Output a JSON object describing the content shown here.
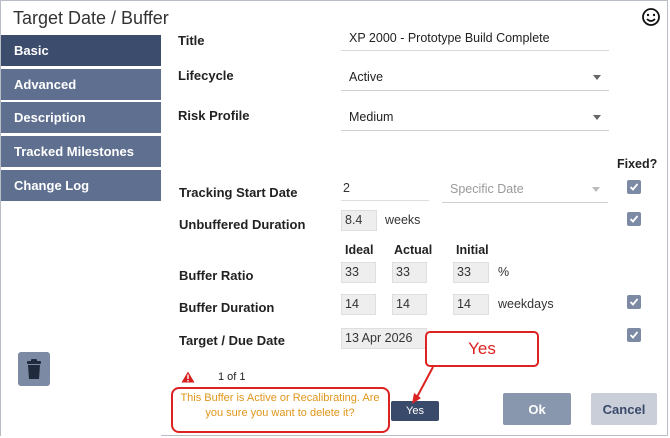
{
  "window": {
    "title": "Target Date / Buffer",
    "smiley_icon": "smiley-face-icon"
  },
  "sidebar": {
    "items": [
      {
        "label": "Basic",
        "active": true
      },
      {
        "label": "Advanced",
        "active": false
      },
      {
        "label": "Description",
        "active": false
      },
      {
        "label": "Tracked Milestones",
        "active": false
      },
      {
        "label": "Change Log",
        "active": false
      }
    ],
    "trash_icon": "trash-icon"
  },
  "form": {
    "title_label": "Title",
    "title_value": "XP 2000 - Prototype Build Complete",
    "lifecycle_label": "Lifecycle",
    "lifecycle_value": "Active",
    "risk_label": "Risk Profile",
    "risk_value": "Medium",
    "fixed_header": "Fixed?",
    "tracking_label": "Tracking Start Date",
    "tracking_value": "2",
    "tracking_select_placeholder": "Specific Date",
    "unbuffered_label": "Unbuffered Duration",
    "unbuffered_value": "8.4",
    "unbuffered_unit": "weeks",
    "col_ideal": "Ideal",
    "col_actual": "Actual",
    "col_initial": "Initial",
    "buffer_ratio_label": "Buffer Ratio",
    "buffer_ratio_ideal": "33",
    "buffer_ratio_actual": "33",
    "buffer_ratio_initial": "33",
    "buffer_ratio_unit": "%",
    "buffer_duration_label": "Buffer Duration",
    "buffer_duration_ideal": "14",
    "buffer_duration_actual": "14",
    "buffer_duration_initial": "14",
    "buffer_duration_unit": "weekdays",
    "target_label": "Target / Due Date",
    "target_value": "13 Apr 2026"
  },
  "footer": {
    "pager_text": "1 of 1",
    "warning_message": "This Buffer is Active or Recalibrating. Are you sure you want to delete it?",
    "confirm_yes_label": "Yes",
    "ok_label": "Ok",
    "cancel_label": "Cancel"
  },
  "annotation": {
    "callout_text": "Yes"
  },
  "colors": {
    "nav_bg": "#5f6f8f",
    "nav_active_bg": "#3c4c6c",
    "warning_text": "#e0961a",
    "annotation_red": "#dd2222"
  }
}
